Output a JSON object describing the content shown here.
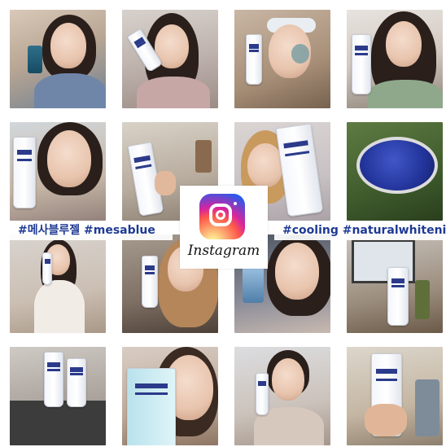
{
  "collage": {
    "tiles": [
      {
        "name": "photo-woman-perfume"
      },
      {
        "name": "photo-woman-with-tube"
      },
      {
        "name": "photo-woman-face-mask"
      },
      {
        "name": "photo-woman-holding-tube"
      },
      {
        "name": "photo-woman-close-up"
      },
      {
        "name": "photo-hand-with-tube"
      },
      {
        "name": "photo-woman-with-large-tube"
      },
      {
        "name": "photo-blue-gel-jar"
      },
      {
        "name": "photo-woman-white-dress"
      },
      {
        "name": "photo-woman-tube-selfie"
      },
      {
        "name": "photo-woman-with-bottle"
      },
      {
        "name": "photo-desk-products"
      },
      {
        "name": "photo-bathroom-shelf-products"
      },
      {
        "name": "photo-tube-on-cheek"
      },
      {
        "name": "photo-woman-short-hair"
      },
      {
        "name": "photo-hand-holding-tubes"
      }
    ]
  },
  "hashtags": {
    "left": "#메사블루젤 #mesablue",
    "right": "#cooling #naturalwhitening"
  },
  "brand": {
    "name": "Instagram",
    "icon": "instagram-icon",
    "accent_color": "#1f3a93"
  }
}
